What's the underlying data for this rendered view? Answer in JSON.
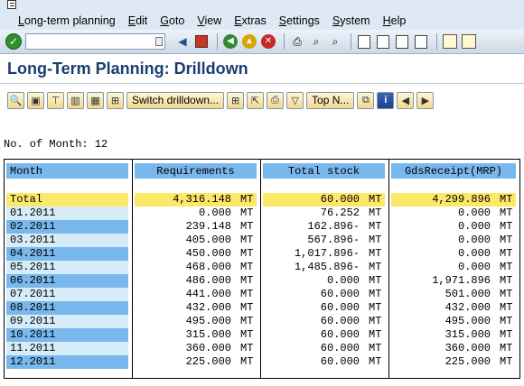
{
  "menu": [
    "Long-term planning",
    "Edit",
    "Goto",
    "View",
    "Extras",
    "Settings",
    "System",
    "Help"
  ],
  "command_field": {
    "value": ""
  },
  "page_title": "Long-Term Planning: Drilldown",
  "app_toolbar": {
    "switch_label": "Switch drilldown...",
    "top_n_label": "Top N..."
  },
  "month_count": "No. of Month: 12",
  "grid": {
    "headers": [
      "Month",
      "Requirements",
      "Total stock",
      "GdsReceipt(MRP)"
    ],
    "unit": "MT",
    "total": {
      "month": "Total",
      "requirements": "4,316.148",
      "total_stock": "60.000",
      "gds_receipt": "4,299.896"
    },
    "rows": [
      {
        "month": "01.2011",
        "requirements": "0.000",
        "total_stock": "76.252",
        "gds_receipt": "0.000"
      },
      {
        "month": "02.2011",
        "requirements": "239.148",
        "total_stock": "162.896-",
        "gds_receipt": "0.000"
      },
      {
        "month": "03.2011",
        "requirements": "405.000",
        "total_stock": "567.896-",
        "gds_receipt": "0.000"
      },
      {
        "month": "04.2011",
        "requirements": "450.000",
        "total_stock": "1,017.896-",
        "gds_receipt": "0.000"
      },
      {
        "month": "05.2011",
        "requirements": "468.000",
        "total_stock": "1,485.896-",
        "gds_receipt": "0.000"
      },
      {
        "month": "06.2011",
        "requirements": "486.000",
        "total_stock": "0.000",
        "gds_receipt": "1,971.896"
      },
      {
        "month": "07.2011",
        "requirements": "441.000",
        "total_stock": "60.000",
        "gds_receipt": "501.000"
      },
      {
        "month": "08.2011",
        "requirements": "432.000",
        "total_stock": "60.000",
        "gds_receipt": "432.000"
      },
      {
        "month": "09.2011",
        "requirements": "495.000",
        "total_stock": "60.000",
        "gds_receipt": "495.000"
      },
      {
        "month": "10.2011",
        "requirements": "315.000",
        "total_stock": "60.000",
        "gds_receipt": "315.000"
      },
      {
        "month": "11.2011",
        "requirements": "360.000",
        "total_stock": "60.000",
        "gds_receipt": "360.000"
      },
      {
        "month": "12.2011",
        "requirements": "225.000",
        "total_stock": "60.000",
        "gds_receipt": "225.000"
      }
    ]
  },
  "colors": {
    "header_blue": "#78b8ec",
    "total_yellow": "#fce868",
    "title_blue": "#1a3e72"
  }
}
